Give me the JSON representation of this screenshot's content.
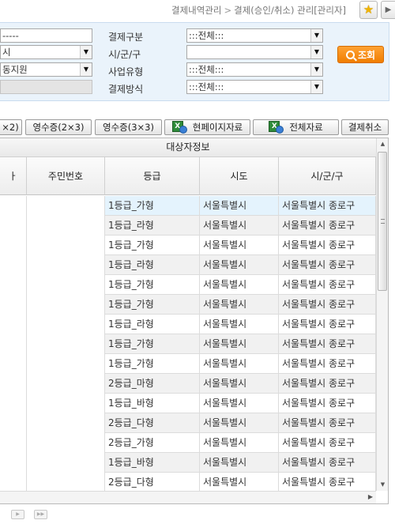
{
  "breadcrumb": {
    "parent": "결제내역관리",
    "separator": ">",
    "current": "결제(승인/취소) 관리[관리자]"
  },
  "search": {
    "left_fields": [
      "-----",
      "시",
      "동지원",
      ""
    ],
    "labels": [
      "결제구분",
      "시/군/구",
      "사업유형",
      "결제방식"
    ],
    "selects": [
      ":::전체:::",
      "",
      ":::전체:::",
      ":::전체:::"
    ],
    "search_button": "조회"
  },
  "toolbar": {
    "btn_partial": "×2)",
    "btn_receipt_2x3": "영수증(2×3)",
    "btn_receipt_3x3": "영수증(3×3)",
    "btn_current_page": "현페이지자료",
    "btn_all_data": "전체자료",
    "btn_cancel_payment": "결제취소"
  },
  "grid": {
    "group_header": "대상자정보",
    "columns": {
      "c0": "ㅏ",
      "id": "주민번호",
      "grade": "등급",
      "sido": "시도",
      "sigungu": "시/군/구"
    },
    "rows": [
      {
        "grade": "1등급_가형",
        "sido": "서울특별시",
        "sigungu": "서울특별시 종로구"
      },
      {
        "grade": "1등급_라형",
        "sido": "서울특별시",
        "sigungu": "서울특별시 종로구"
      },
      {
        "grade": "1등급_가형",
        "sido": "서울특별시",
        "sigungu": "서울특별시 종로구"
      },
      {
        "grade": "1등급_라형",
        "sido": "서울특별시",
        "sigungu": "서울특별시 종로구"
      },
      {
        "grade": "1등급_가형",
        "sido": "서울특별시",
        "sigungu": "서울특별시 종로구"
      },
      {
        "grade": "1등급_가형",
        "sido": "서울특별시",
        "sigungu": "서울특별시 종로구"
      },
      {
        "grade": "1등급_라형",
        "sido": "서울특별시",
        "sigungu": "서울특별시 종로구"
      },
      {
        "grade": "1등급_가형",
        "sido": "서울특별시",
        "sigungu": "서울특별시 종로구"
      },
      {
        "grade": "1등급_가형",
        "sido": "서울특별시",
        "sigungu": "서울특별시 종로구"
      },
      {
        "grade": "2등급_마형",
        "sido": "서울특별시",
        "sigungu": "서울특별시 종로구"
      },
      {
        "grade": "1등급_바형",
        "sido": "서울특별시",
        "sigungu": "서울특별시 종로구"
      },
      {
        "grade": "2등급_다형",
        "sido": "서울특별시",
        "sigungu": "서울특별시 종로구"
      },
      {
        "grade": "2등급_가형",
        "sido": "서울특별시",
        "sigungu": "서울특별시 종로구"
      },
      {
        "grade": "1등급_바형",
        "sido": "서울특별시",
        "sigungu": "서울특별시 종로구"
      },
      {
        "grade": "2등급_다형",
        "sido": "서울특별시",
        "sigungu": "서울특별시 종로구"
      }
    ]
  },
  "icons": {
    "star": "star-icon",
    "excel": "excel-download-icon",
    "search": "search-icon"
  },
  "colors": {
    "search_panel": "#eaf3fb",
    "search_button": "#f08a10",
    "selected_row": "#e4f3fd"
  }
}
